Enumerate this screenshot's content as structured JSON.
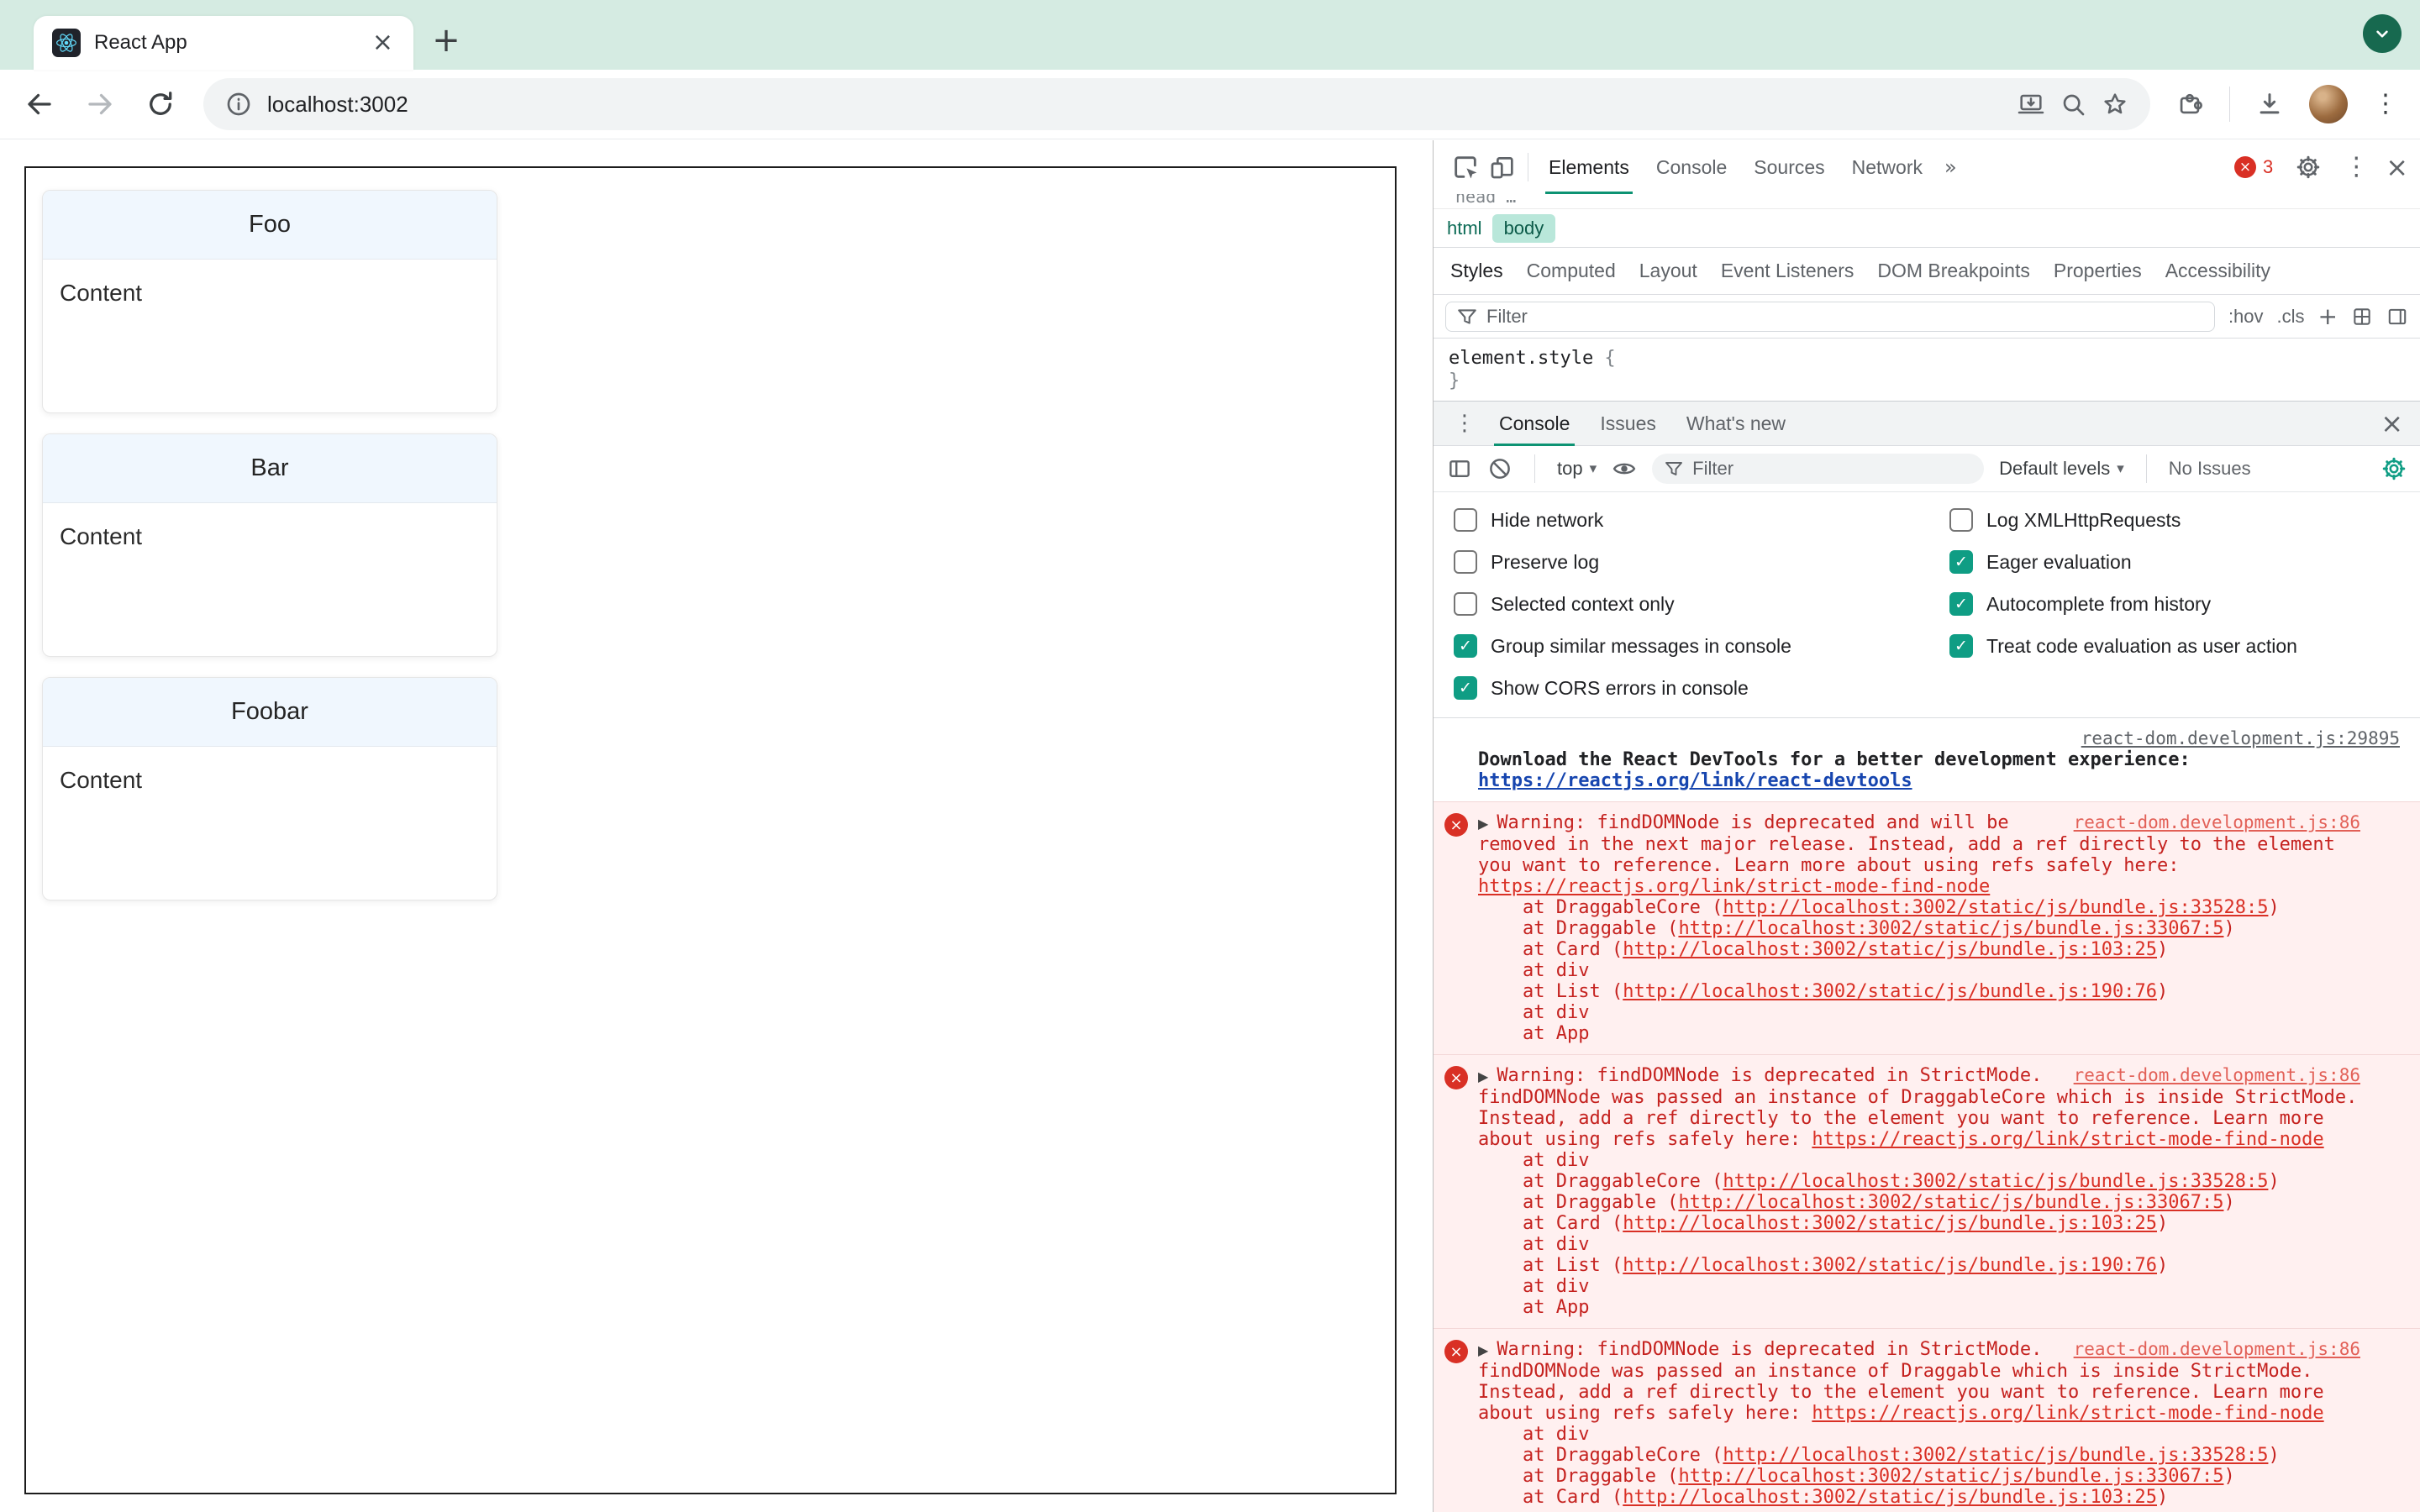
{
  "icons": {
    "caret": "▾",
    "expand": "▶",
    "kebab": "⋮",
    "close": "×",
    "more": "»",
    "check": "✓",
    "plus": "+",
    "badge_x": "×"
  },
  "browser": {
    "tab_title": "React App",
    "url": "localhost:3002"
  },
  "page": {
    "cards": [
      {
        "title": "Foo",
        "body": "Content"
      },
      {
        "title": "Bar",
        "body": "Content"
      },
      {
        "title": "Foobar",
        "body": "Content"
      }
    ]
  },
  "devtools": {
    "tabs": [
      "Elements",
      "Console",
      "Sources",
      "Network"
    ],
    "error_count": "3",
    "peek_text": "head …",
    "crumbs": {
      "html": "html",
      "body": "body"
    },
    "styles_tabs": [
      "Styles",
      "Computed",
      "Layout",
      "Event Listeners",
      "DOM Breakpoints",
      "Properties",
      "Accessibility"
    ],
    "styles_filter": {
      "placeholder": "Filter",
      "hov": ":hov",
      "cls": ".cls"
    },
    "element_style": {
      "selector": "element.style",
      "open": " {",
      "close": "}"
    },
    "drawer": {
      "tabs": [
        "Console",
        "Issues",
        "What's new"
      ],
      "toolbar": {
        "context": "top",
        "filter_placeholder": "Filter",
        "levels": "Default levels",
        "no_issues": "No Issues"
      },
      "settings": {
        "left": [
          {
            "label": "Hide network",
            "checked": false
          },
          {
            "label": "Preserve log",
            "checked": false
          },
          {
            "label": "Selected context only",
            "checked": false
          },
          {
            "label": "Group similar messages in console",
            "checked": true
          },
          {
            "label": "Show CORS errors in console",
            "checked": true
          }
        ],
        "right": [
          {
            "label": "Log XMLHttpRequests",
            "checked": false
          },
          {
            "label": "Eager evaluation",
            "checked": true
          },
          {
            "label": "Autocomplete from history",
            "checked": true
          },
          {
            "label": "Treat code evaluation as user action",
            "checked": true
          }
        ]
      },
      "info": {
        "source": "react-dom.development.js:29895",
        "text": "Download the React DevTools for a better development experience: ",
        "link": "https://reactjs.org/link/react-devtools"
      },
      "errors": [
        {
          "source": "react-dom.development.js:86",
          "text": "Warning: findDOMNode is deprecated and will be removed in the next major release. Instead, add a ref directly to the element you want to reference. Learn more about using refs safely here: ",
          "link": "https://reactjs.org/link/strict-mode-find-node",
          "stack": [
            {
              "pre": "at DraggableCore (",
              "url": "http://localhost:3002/static/js/bundle.js:33528:5",
              "suf": ")"
            },
            {
              "pre": "at Draggable (",
              "url": "http://localhost:3002/static/js/bundle.js:33067:5",
              "suf": ")"
            },
            {
              "pre": "at Card (",
              "url": "http://localhost:3002/static/js/bundle.js:103:25",
              "suf": ")"
            },
            {
              "pre": "at div",
              "url": "",
              "suf": ""
            },
            {
              "pre": "at List (",
              "url": "http://localhost:3002/static/js/bundle.js:190:76",
              "suf": ")"
            },
            {
              "pre": "at div",
              "url": "",
              "suf": ""
            },
            {
              "pre": "at App",
              "url": "",
              "suf": ""
            }
          ]
        },
        {
          "source": "react-dom.development.js:86",
          "text": "Warning: findDOMNode is deprecated in StrictMode. findDOMNode was passed an instance of DraggableCore which is inside StrictMode. Instead, add a ref directly to the element you want to reference. Learn more about using refs safely here: ",
          "link": "https://reactjs.org/link/strict-mode-find-node",
          "stack": [
            {
              "pre": "at div",
              "url": "",
              "suf": ""
            },
            {
              "pre": "at DraggableCore (",
              "url": "http://localhost:3002/static/js/bundle.js:33528:5",
              "suf": ")"
            },
            {
              "pre": "at Draggable (",
              "url": "http://localhost:3002/static/js/bundle.js:33067:5",
              "suf": ")"
            },
            {
              "pre": "at Card (",
              "url": "http://localhost:3002/static/js/bundle.js:103:25",
              "suf": ")"
            },
            {
              "pre": "at div",
              "url": "",
              "suf": ""
            },
            {
              "pre": "at List (",
              "url": "http://localhost:3002/static/js/bundle.js:190:76",
              "suf": ")"
            },
            {
              "pre": "at div",
              "url": "",
              "suf": ""
            },
            {
              "pre": "at App",
              "url": "",
              "suf": ""
            }
          ]
        },
        {
          "source": "react-dom.development.js:86",
          "text": "Warning: findDOMNode is deprecated in StrictMode. findDOMNode was passed an instance of Draggable which is inside StrictMode. Instead, add a ref directly to the element you want to reference. Learn more about using refs safely here: ",
          "link": "https://reactjs.org/link/strict-mode-find-node",
          "stack": [
            {
              "pre": "at div",
              "url": "",
              "suf": ""
            },
            {
              "pre": "at DraggableCore (",
              "url": "http://localhost:3002/static/js/bundle.js:33528:5",
              "suf": ")"
            },
            {
              "pre": "at Draggable (",
              "url": "http://localhost:3002/static/js/bundle.js:33067:5",
              "suf": ")"
            },
            {
              "pre": "at Card (",
              "url": "http://localhost:3002/static/js/bundle.js:103:25",
              "suf": ")"
            }
          ]
        }
      ]
    }
  }
}
